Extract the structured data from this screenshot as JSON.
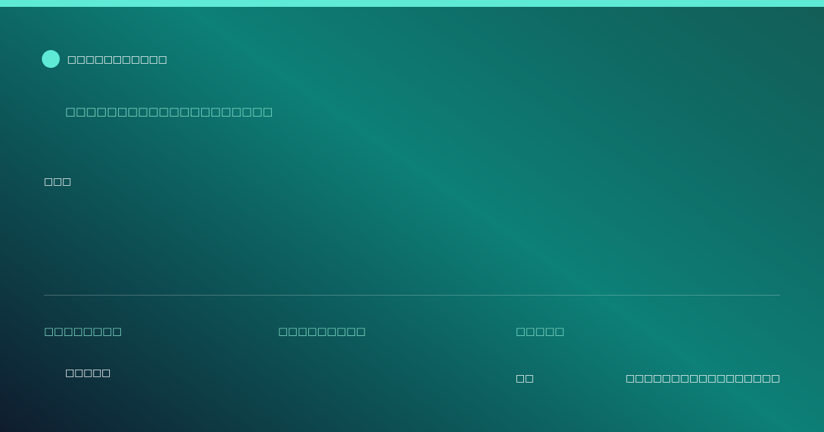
{
  "colors": {
    "accent": "#5eead4",
    "accent_text": "#7fdcc8"
  },
  "brand": {
    "icon": "brand-dot-icon",
    "name": "□□□□□□□□□□□"
  },
  "tagline": "□□□□□□□□□□□□□□□□□□□□",
  "main": {
    "text": "□□□"
  },
  "stats": [
    {
      "label": "□□□□□□□□",
      "value": "□□□□□"
    },
    {
      "label": "□□□□□□□□□",
      "value": ""
    },
    {
      "label": "□□□□□",
      "value": "□□"
    }
  ],
  "footer": {
    "url": "□□□□□□□□□□□□□□□□□"
  }
}
